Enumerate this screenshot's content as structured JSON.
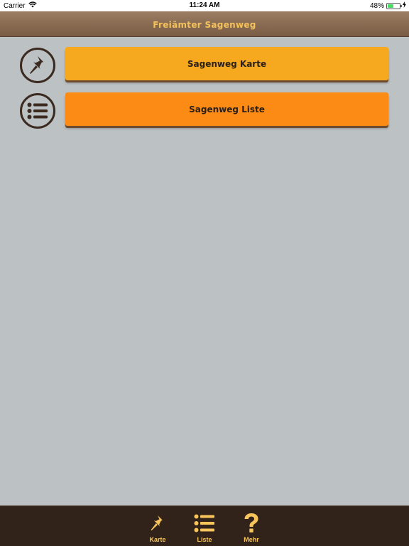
{
  "status_bar": {
    "carrier": "Carrier",
    "time": "11:24 AM",
    "battery": "48%",
    "battery_level": 0.48
  },
  "nav": {
    "title": "Freiämter Sagenweg"
  },
  "menu": {
    "items": [
      {
        "label": "Sagenweg Karte",
        "icon": "pushpin-icon",
        "color": "#f6a91e"
      },
      {
        "label": "Sagenweg Liste",
        "icon": "list-icon",
        "color": "#fb8b14"
      }
    ]
  },
  "tab_bar": {
    "items": [
      {
        "label": "Karte",
        "icon": "pushpin-icon"
      },
      {
        "label": "Liste",
        "icon": "list-icon"
      },
      {
        "label": "Mehr",
        "icon": "question-icon"
      }
    ]
  },
  "colors": {
    "background": "#bcc1c4",
    "nav_title": "#f5c15c",
    "icon_dark": "#3b2a1f",
    "tab_bar": "#32231a",
    "tab_icon": "#f8c45c"
  }
}
